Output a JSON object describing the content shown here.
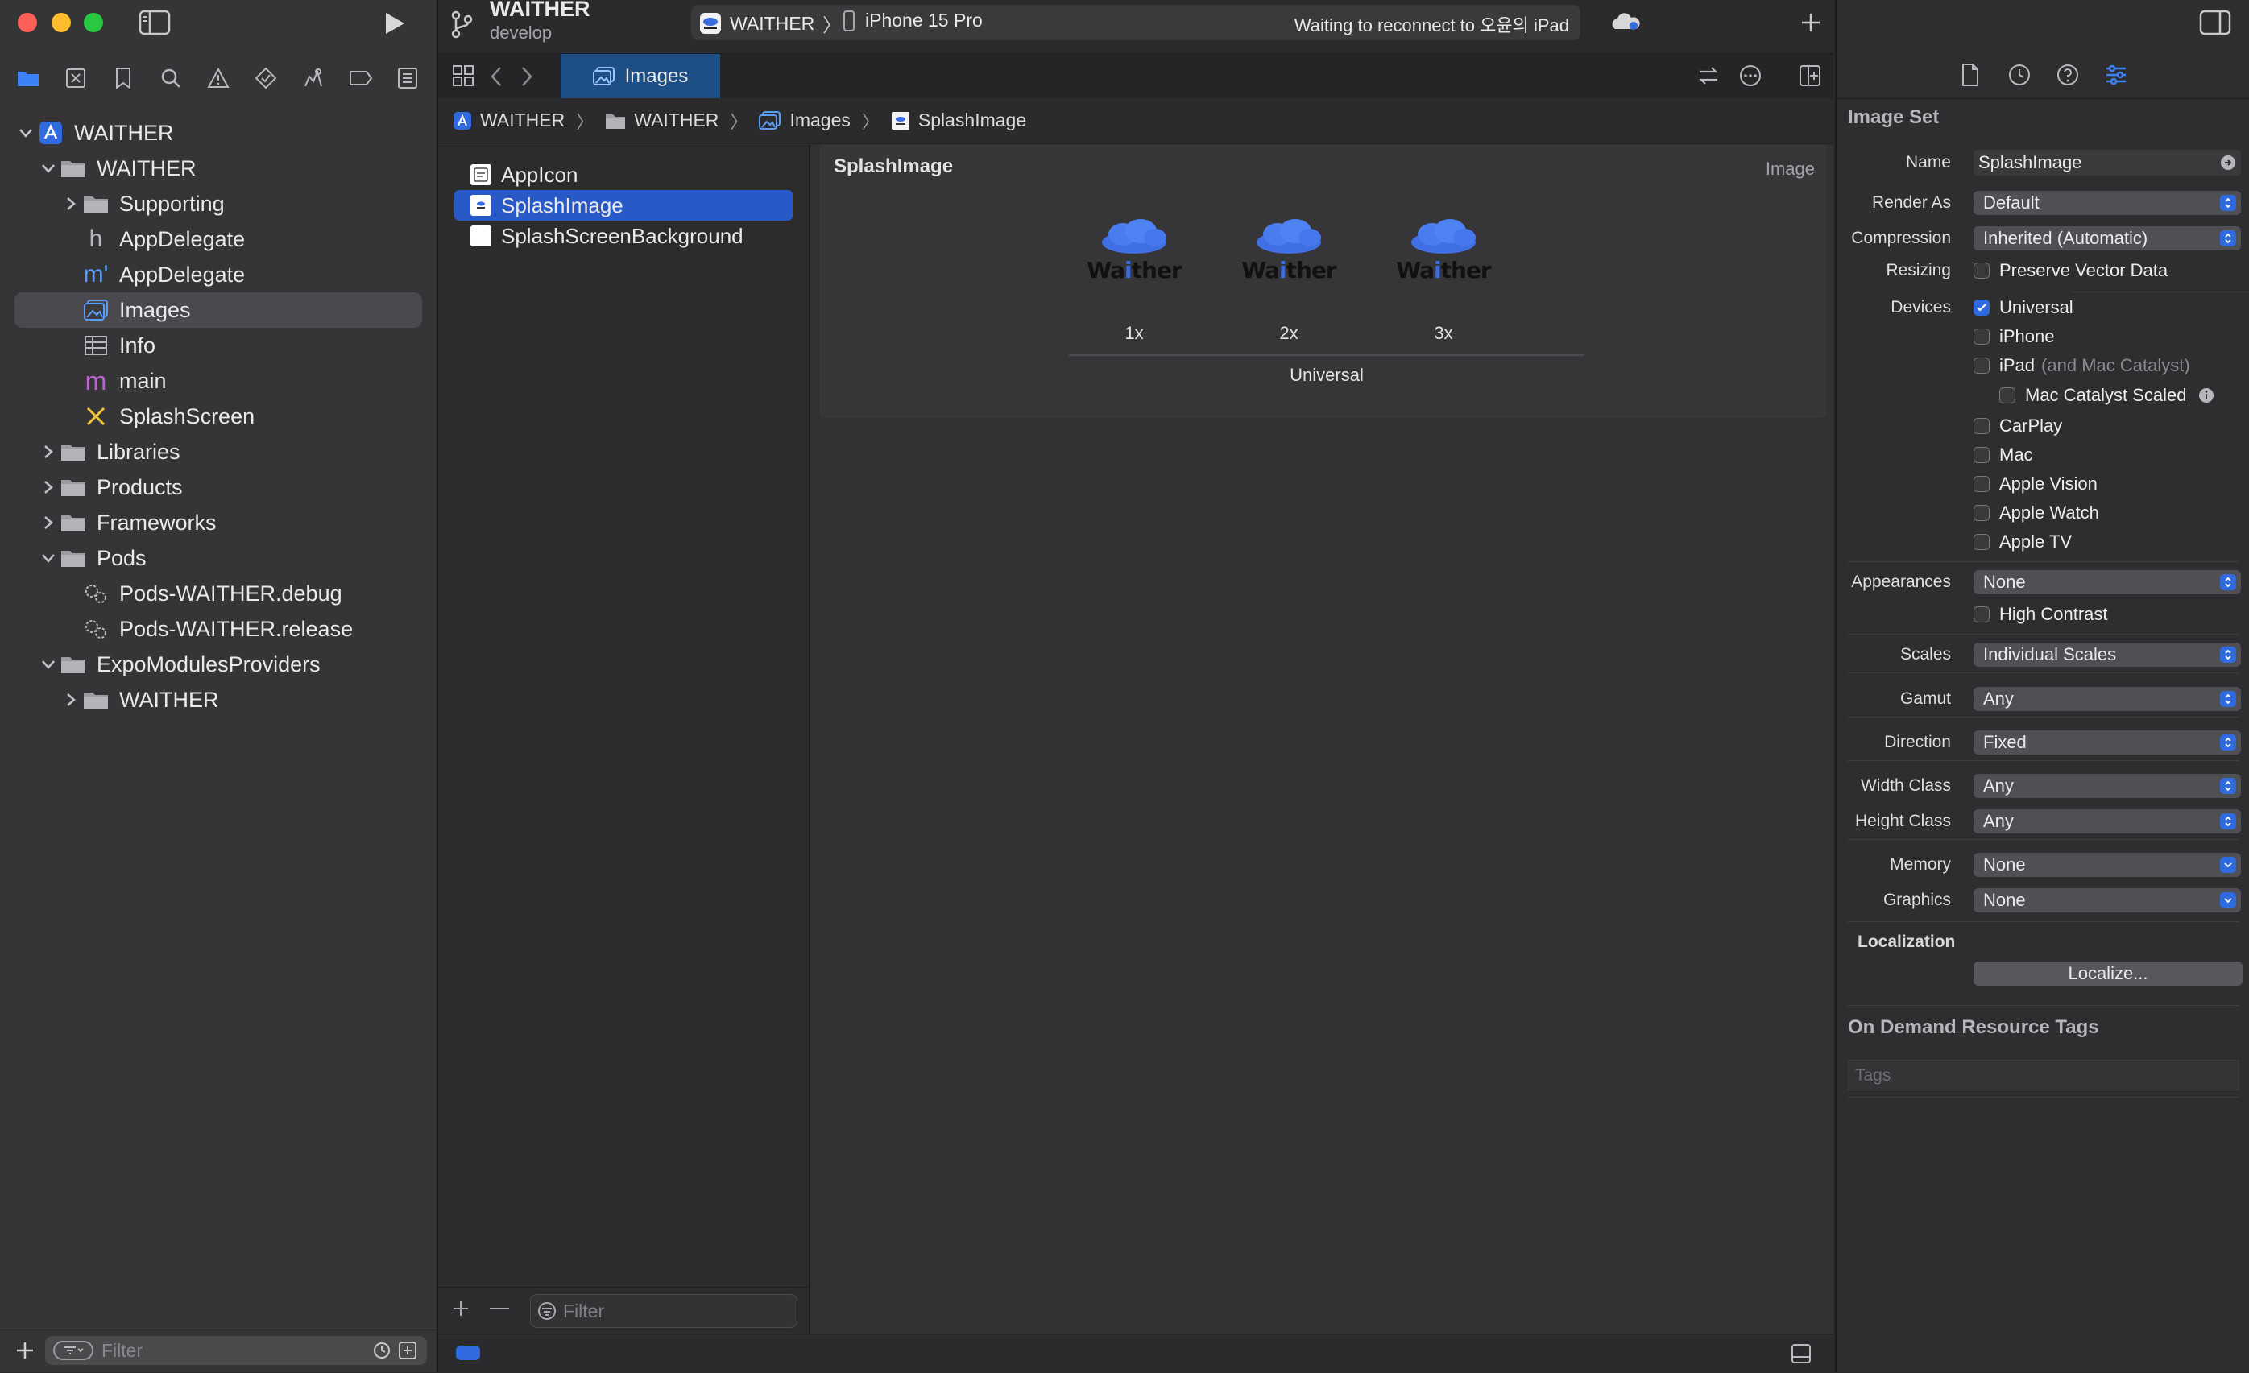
{
  "project": {
    "name": "WAITHER",
    "branch": "develop"
  },
  "scheme": {
    "target": "WAITHER",
    "device": "iPhone 15 Pro",
    "status": "Waiting to reconnect to 오윤의 iPad"
  },
  "navigator": {
    "tree": [
      {
        "label": "WAITHER",
        "depth": 0,
        "icon": "project-icon",
        "chevron": "down"
      },
      {
        "label": "WAITHER",
        "depth": 1,
        "icon": "folder-icon",
        "chevron": "down"
      },
      {
        "label": "Supporting",
        "depth": 2,
        "icon": "folder-icon",
        "chevron": "right"
      },
      {
        "label": "AppDelegate",
        "depth": 2,
        "icon": "header-file-icon",
        "chevron": ""
      },
      {
        "label": "AppDelegate",
        "depth": 2,
        "icon": "objc-file-icon",
        "chevron": ""
      },
      {
        "label": "Images",
        "depth": 2,
        "icon": "asset-catalog-icon",
        "chevron": "",
        "selected": true
      },
      {
        "label": "Info",
        "depth": 2,
        "icon": "plist-icon",
        "chevron": ""
      },
      {
        "label": "main",
        "depth": 2,
        "icon": "source-file-icon",
        "chevron": ""
      },
      {
        "label": "SplashScreen",
        "depth": 2,
        "icon": "storyboard-icon",
        "chevron": ""
      },
      {
        "label": "Libraries",
        "depth": 1,
        "icon": "folder-icon",
        "chevron": "right"
      },
      {
        "label": "Products",
        "depth": 1,
        "icon": "folder-icon",
        "chevron": "right"
      },
      {
        "label": "Frameworks",
        "depth": 1,
        "icon": "folder-icon",
        "chevron": "right"
      },
      {
        "label": "Pods",
        "depth": 1,
        "icon": "folder-icon",
        "chevron": "down"
      },
      {
        "label": "Pods-WAITHER.debug",
        "depth": 2,
        "icon": "xcconfig-icon",
        "chevron": ""
      },
      {
        "label": "Pods-WAITHER.release",
        "depth": 2,
        "icon": "xcconfig-icon",
        "chevron": ""
      },
      {
        "label": "ExpoModulesProviders",
        "depth": 1,
        "icon": "folder-icon",
        "chevron": "down"
      },
      {
        "label": "WAITHER",
        "depth": 2,
        "icon": "folder-icon",
        "chevron": "right"
      }
    ],
    "filter_placeholder": "Filter"
  },
  "tabs": [
    {
      "label": "Images"
    }
  ],
  "breadcrumb": [
    "WAITHER",
    "WAITHER",
    "Images",
    "SplashImage"
  ],
  "assets": {
    "items": [
      {
        "label": "AppIcon"
      },
      {
        "label": "SplashImage",
        "selected": true
      },
      {
        "label": "SplashScreenBackground"
      }
    ],
    "filter_placeholder": "Filter"
  },
  "editor": {
    "set_name": "SplashImage",
    "set_kind": "Image",
    "wordmark": {
      "pre": "Wa",
      "mid": "i",
      "post": "ther"
    },
    "scales": [
      "1x",
      "2x",
      "3x"
    ],
    "group_label": "Universal"
  },
  "inspector": {
    "title": "Image Set",
    "name_label": "Name",
    "name_value": "SplashImage",
    "render_as_label": "Render As",
    "render_as": "Default",
    "compression_label": "Compression",
    "compression": "Inherited (Automatic)",
    "resizing_label": "Resizing",
    "resizing_option": "Preserve Vector Data",
    "devices_label": "Devices",
    "devices": [
      {
        "label": "Universal",
        "checked": true
      },
      {
        "label": "iPhone",
        "checked": false
      },
      {
        "label": "iPad",
        "suffix": "(and Mac Catalyst)",
        "checked": false
      },
      {
        "label": "Mac Catalyst Scaled",
        "checked": false,
        "indent": true
      },
      {
        "label": "CarPlay",
        "checked": false
      },
      {
        "label": "Mac",
        "checked": false
      },
      {
        "label": "Apple Vision",
        "checked": false
      },
      {
        "label": "Apple Watch",
        "checked": false
      },
      {
        "label": "Apple TV",
        "checked": false
      }
    ],
    "appearances_label": "Appearances",
    "appearances": "None",
    "high_contrast": "High Contrast",
    "scales_label": "Scales",
    "scales": "Individual Scales",
    "gamut_label": "Gamut",
    "gamut": "Any",
    "direction_label": "Direction",
    "direction": "Fixed",
    "width_class_label": "Width Class",
    "width_class": "Any",
    "height_class_label": "Height Class",
    "height_class": "Any",
    "memory_label": "Memory",
    "memory": "None",
    "graphics_label": "Graphics",
    "graphics": "None",
    "localization_label": "Localization",
    "localize_button": "Localize...",
    "odr_title": "On Demand Resource Tags",
    "tags_placeholder": "Tags"
  },
  "colors": {
    "accent": "#2f6bde",
    "selection": "#2959c6",
    "tab": "#1d4f86"
  }
}
